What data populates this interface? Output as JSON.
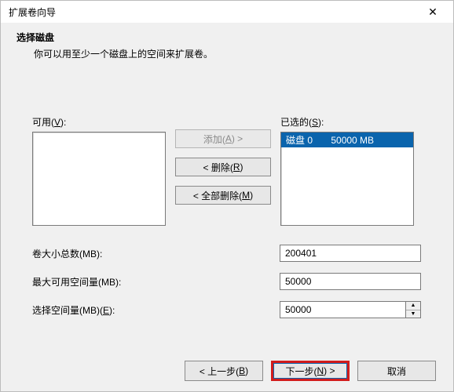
{
  "window": {
    "title": "扩展卷向导",
    "close": "✕"
  },
  "header": {
    "title": "选择磁盘",
    "subtitle": "你可以用至少一个磁盘上的空间来扩展卷。"
  },
  "lists": {
    "available_label_pre": "可用(",
    "available_accel": "V",
    "available_label_post": "):",
    "selected_label_pre": "已选的(",
    "selected_accel": "S",
    "selected_label_post": "):",
    "available_items": [],
    "selected_items": [
      {
        "text": "磁盘 0       50000 MB",
        "selected": true
      }
    ]
  },
  "buttons": {
    "add_pre": "添加(",
    "add_accel": "A",
    "add_post": ") >",
    "remove_pre": "< 删除(",
    "remove_accel": "R",
    "remove_post": ")",
    "remove_all_pre": "< 全部删除(",
    "remove_all_accel": "M",
    "remove_all_post": ")"
  },
  "fields": {
    "total_label": "卷大小总数(MB):",
    "total_value": "200401",
    "max_label": "最大可用空间量(MB):",
    "max_value": "50000",
    "select_label_pre": "选择空间量(MB)(",
    "select_accel": "E",
    "select_label_post": "):",
    "select_value": "50000"
  },
  "footer": {
    "back_pre": "< 上一步(",
    "back_accel": "B",
    "back_post": ")",
    "next_pre": "下一步(",
    "next_accel": "N",
    "next_post": ") >",
    "cancel": "取消"
  }
}
